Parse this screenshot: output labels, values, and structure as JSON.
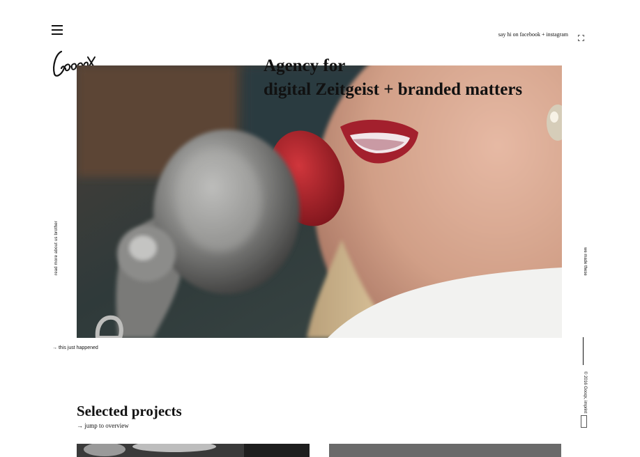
{
  "header": {
    "menu_icon": "hamburger-icon",
    "logo_text": "Gooqx",
    "social_link": "say hi on facebook + instagram",
    "fullscreen_icon": "fullscreen-icon"
  },
  "hero": {
    "headline_line1": "Agency for",
    "headline_line2": "digital Zeitgeist + branded matters",
    "image": "woman-singing-into-vintage-microphone"
  },
  "side": {
    "left_text": "read more about us brother",
    "right_text": "we made these",
    "copyright": "© 2016 Gooqx, imprint"
  },
  "happened_link": "→ this just happened",
  "projects": {
    "title": "Selected projects",
    "jump_link": "→ jump to overview"
  },
  "colors": {
    "text": "#111111",
    "lipstick": "#a3202d",
    "microphone_red": "#b0222a",
    "background": "#ffffff"
  }
}
